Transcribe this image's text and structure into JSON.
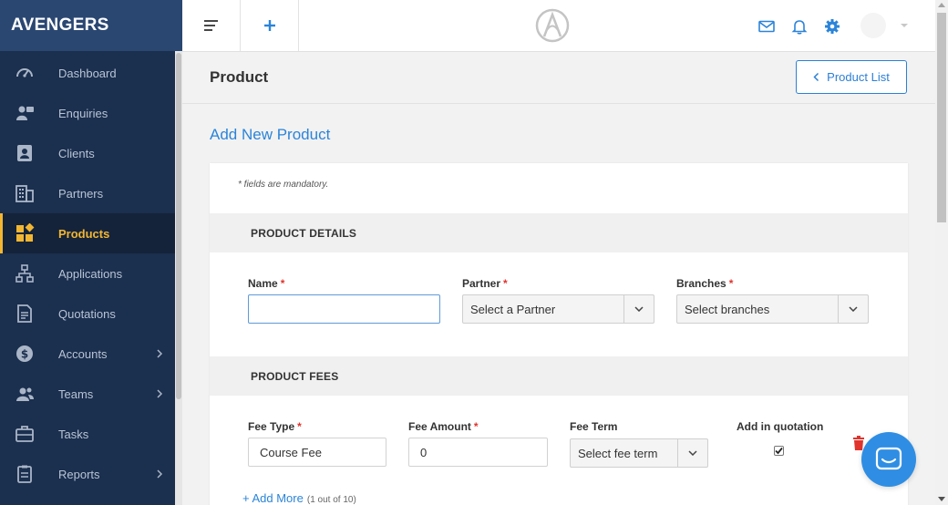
{
  "app": {
    "brand": "AVENGERS"
  },
  "sidebar": {
    "items": [
      {
        "label": "Dashboard",
        "icon": "gauge-icon"
      },
      {
        "label": "Enquiries",
        "icon": "enquiries-icon"
      },
      {
        "label": "Clients",
        "icon": "contact-card-icon"
      },
      {
        "label": "Partners",
        "icon": "building-icon"
      },
      {
        "label": "Products",
        "icon": "products-grid-icon",
        "active": true
      },
      {
        "label": "Applications",
        "icon": "sitemap-icon"
      },
      {
        "label": "Quotations",
        "icon": "document-icon"
      },
      {
        "label": "Accounts",
        "icon": "dollar-circle-icon",
        "expandable": true
      },
      {
        "label": "Teams",
        "icon": "team-icon",
        "expandable": true
      },
      {
        "label": "Tasks",
        "icon": "briefcase-icon"
      },
      {
        "label": "Reports",
        "icon": "clipboard-icon",
        "expandable": true
      }
    ]
  },
  "topbar": {
    "icons": [
      "menu-icon",
      "plus-icon",
      "mail-icon",
      "bell-icon",
      "gear-icon",
      "avatar",
      "caret-down-icon"
    ]
  },
  "page": {
    "title": "Product",
    "back_button": "Product List",
    "section_title": "Add New Product",
    "mandatory_note": "* fields are mandatory."
  },
  "product_details": {
    "heading": "PRODUCT DETAILS",
    "name_label": "Name",
    "name_value": "",
    "partner_label": "Partner",
    "partner_value": "Select a Partner",
    "branches_label": "Branches",
    "branches_value": "Select branches"
  },
  "product_fees": {
    "heading": "PRODUCT FEES",
    "fee_type_label": "Fee Type",
    "fee_type_value": "Course Fee",
    "fee_amount_label": "Fee Amount",
    "fee_amount_value": "0",
    "fee_term_label": "Fee Term",
    "fee_term_value": "Select fee term",
    "add_in_quotation_label": "Add in quotation",
    "add_in_quotation_checked": true,
    "add_more_label": "+ Add More",
    "add_more_count": "(1 out of 10)"
  },
  "colors": {
    "sidebar_bg": "#1b2f4e",
    "brand_bg": "#2a4772",
    "active_accent": "#f2b632",
    "link_blue": "#2b84d9",
    "required_red": "#e0342d"
  }
}
